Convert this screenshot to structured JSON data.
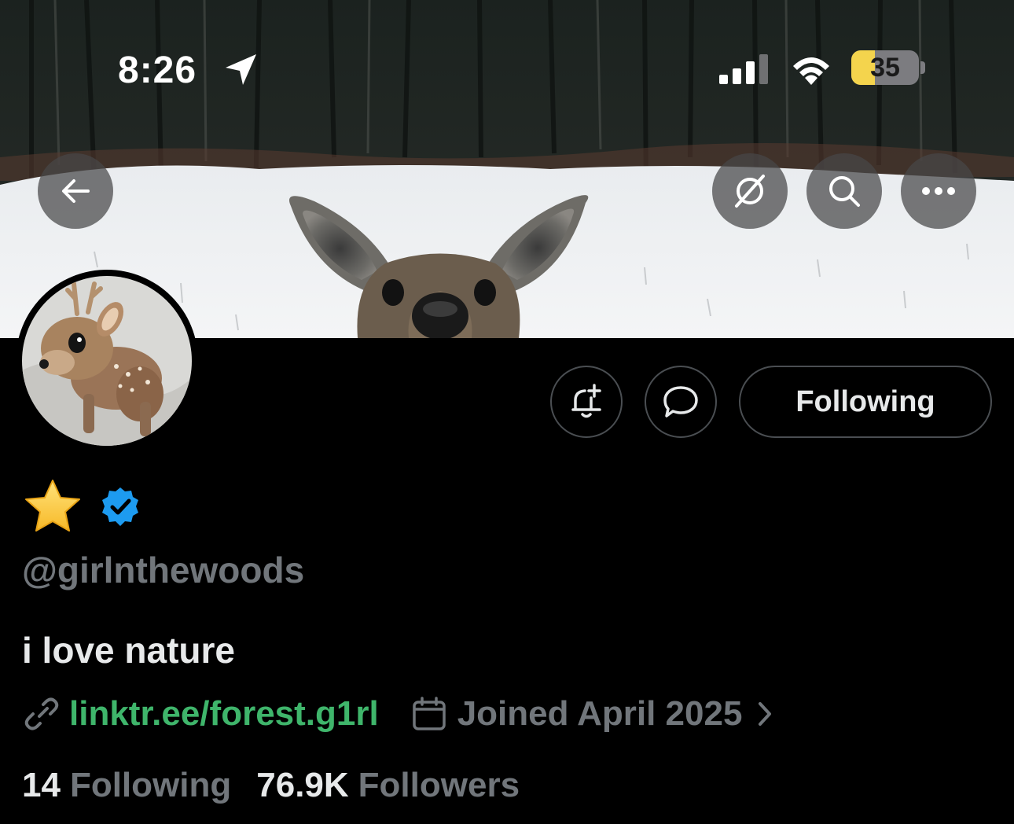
{
  "status_bar": {
    "time": "8:26",
    "battery_percent": "35",
    "battery_level": 0.35,
    "icons": [
      "location-arrow-icon",
      "cellular-signal-icon",
      "wifi-icon",
      "battery-icon"
    ]
  },
  "top_nav": {
    "icons": [
      "back-arrow-icon",
      "grok-icon",
      "search-icon",
      "more-icon"
    ]
  },
  "profile": {
    "display_name_emoji": "⭐",
    "verified": true,
    "handle": "@girlnthewoods",
    "bio": "i love nature",
    "link": "linktr.ee/forest.g1rl",
    "joined": "Joined April 2025",
    "following_count": "14",
    "following_label": "Following",
    "followers_count": "76.9K",
    "followers_label": "Followers"
  },
  "actions": {
    "following_button": "Following",
    "icons": [
      "notification-bell-plus-icon",
      "message-bubble-icon"
    ]
  },
  "colors": {
    "background": "#000000",
    "text_primary": "#e7e9ea",
    "text_secondary": "#71767b",
    "link": "#3fb56b",
    "verified": "#1d9bf0",
    "battery_fill": "#f4d44d"
  }
}
